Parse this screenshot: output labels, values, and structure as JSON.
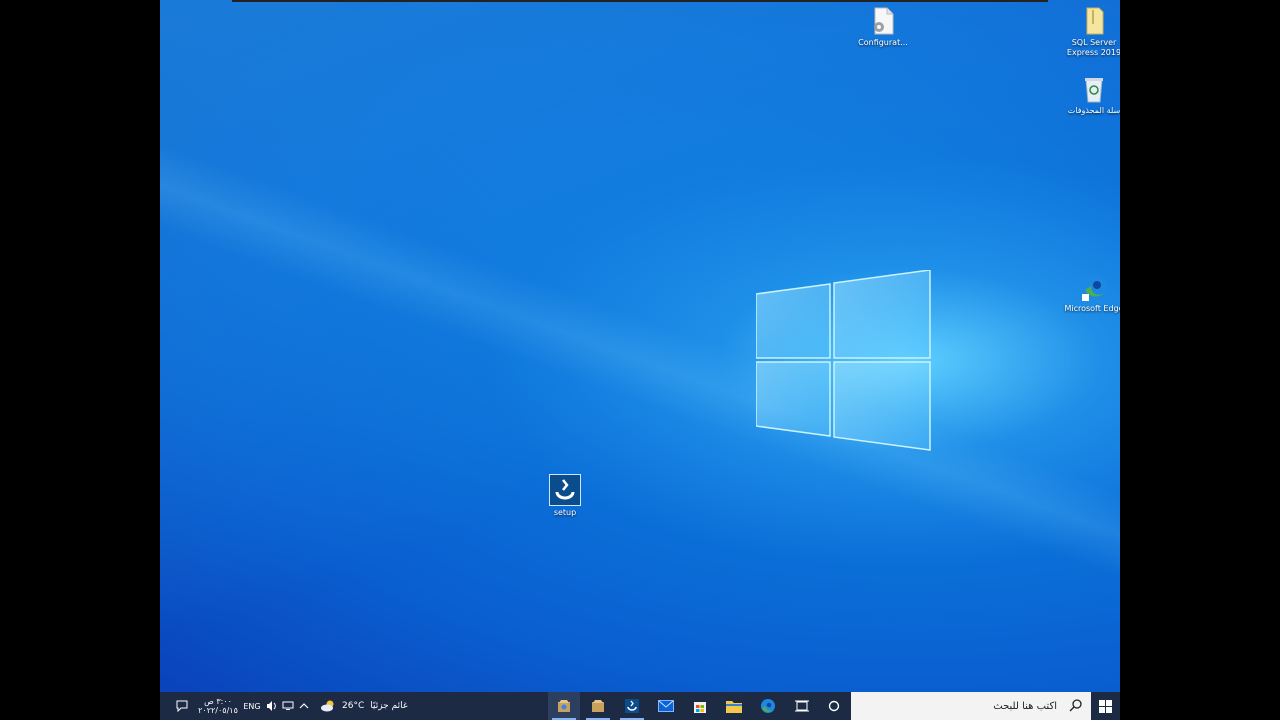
{
  "desktop": {
    "icons": [
      {
        "label": "Configurat..."
      },
      {
        "label": "SQL Server Express 2019"
      },
      {
        "label": "سلة المحذوفات"
      },
      {
        "label": "Microsoft Edge"
      },
      {
        "label": "setup"
      }
    ]
  },
  "taskbar": {
    "search_placeholder": "اكتب هنا للبحث",
    "weather_temp": "26°C",
    "weather_text": "غائم جزئيًا",
    "language": "ENG",
    "time": "٣:٠٠ ص",
    "date": "٢٠٢٢/٠٥/١٥",
    "pinned": [
      "installer-icon",
      "package-icon",
      "setup-app-icon",
      "mail-icon",
      "store-icon",
      "file-explorer-icon",
      "edge-icon"
    ]
  },
  "colors": {
    "accent": "#0a6fd8",
    "taskbar": "#1c2a44"
  }
}
